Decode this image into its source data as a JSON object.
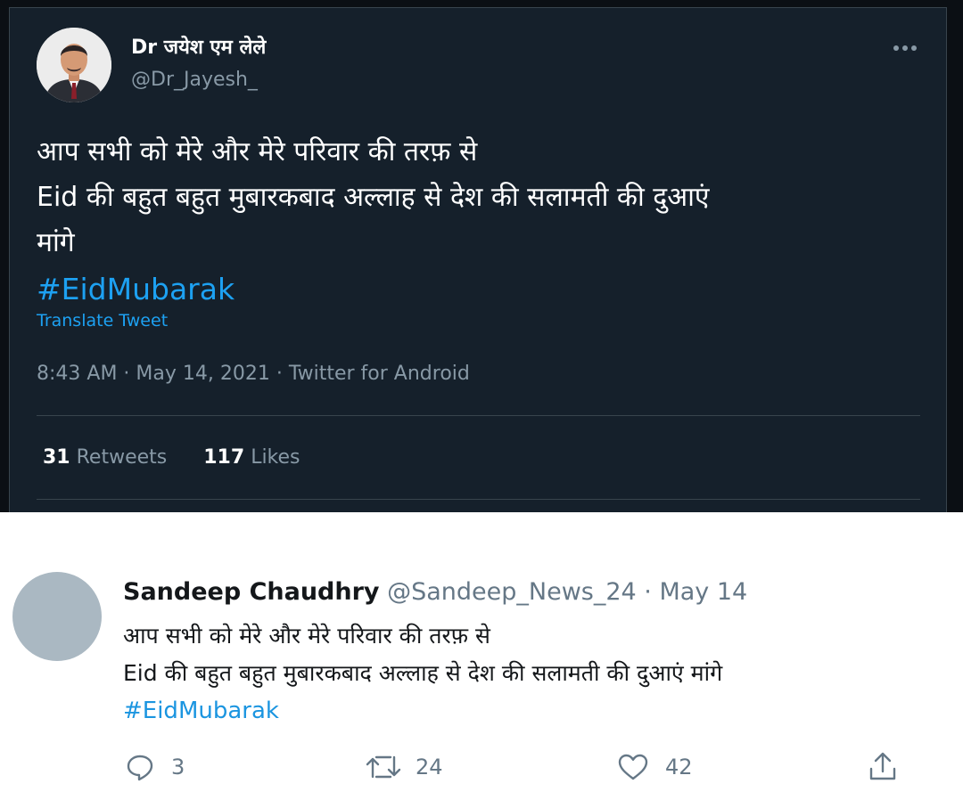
{
  "dark_tweet": {
    "display_name": "Dr जयेश एम लेले",
    "handle": "@Dr_Jayesh_",
    "body_lines": [
      "आप सभी को मेरे और मेरे परिवार की तरफ़ से",
      "Eid की बहुत बहुत मुबारकबाद अल्लाह से देश की सलामती की दुआएं",
      "मांगे"
    ],
    "hashtag": "#EidMubarak",
    "translate_label": "Translate Tweet",
    "meta": "8:43 AM · May 14, 2021 · Twitter for Android",
    "retweets_count": "31",
    "retweets_label": "Retweets",
    "likes_count": "117",
    "likes_label": "Likes",
    "more_icon": "more-horizontal-icon"
  },
  "light_tweet": {
    "display_name": "Sandeep Chaudhry",
    "handle_and_date": "@Sandeep_News_24 · May 14",
    "body_lines": [
      "आप सभी को मेरे और मेरे परिवार की तरफ़ से",
      "Eid की बहुत बहुत मुबारकबाद अल्लाह से देश की सलामती की दुआएं मांगे"
    ],
    "hashtag": "#EidMubarak",
    "reply_count": "3",
    "retweet_count": "24",
    "like_count": "42",
    "icons": [
      "reply-icon",
      "retweet-icon",
      "like-icon",
      "share-icon"
    ]
  },
  "colors": {
    "dark_background": "#15202b",
    "link_blue": "#1da1f2",
    "light_link_blue": "#1b95e0",
    "muted_gray": "#8899a6"
  }
}
